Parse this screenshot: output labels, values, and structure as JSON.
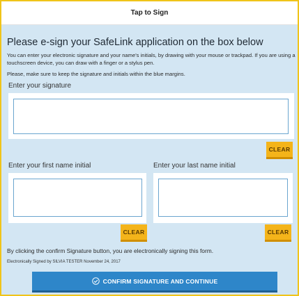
{
  "header": {
    "title": "Tap to Sign"
  },
  "main": {
    "heading": "Please e-sign your SafeLink application on the box below",
    "instructions": "You can enter your electronic signature and your name's initials, by drawing with your mouse or trackpad. If you are using a touchscreen device, you can draw with a finger or a stylus pen.",
    "note": "Please, make sure to keep the signature and initials within the blue margins.",
    "signature": {
      "label": "Enter your signature",
      "clear_label": "CLEAR"
    },
    "first_initial": {
      "label": "Enter your first name initial",
      "clear_label": "CLEAR"
    },
    "last_initial": {
      "label": "Enter your last name initial",
      "clear_label": "CLEAR"
    },
    "legal_text": "By clicking the confirm Signature button, you are electronically signing this form.",
    "signed_by": "Electronically Signed by SILVIA TESTER November 24, 2017",
    "confirm_label": "CONFIRM SIGNATURE AND CONTINUE",
    "confirm_icon": "check-circle-icon"
  },
  "colors": {
    "panel_bg": "#d3e6f3",
    "frame_border": "#f0c419",
    "clear_button": "#f4b41a",
    "confirm_button": "#2e86c9",
    "box_border": "#6aa5cf"
  }
}
